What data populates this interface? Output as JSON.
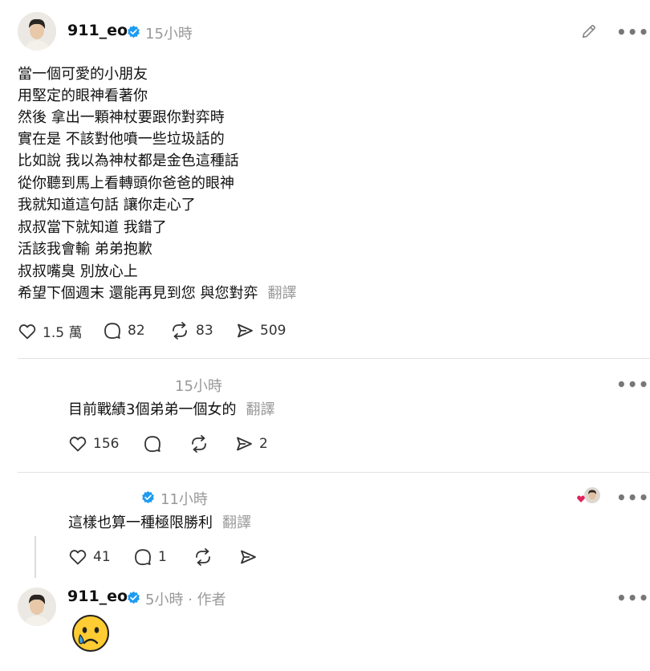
{
  "main_post": {
    "username": "911_eo",
    "time": "15小時",
    "lines": [
      "當一個可愛的小朋友",
      "用堅定的眼神看著你",
      "然後 拿出一顆神杖要跟你對弈時",
      "實在是 不該對他噴一些垃圾話的",
      "比如說 我以為神杖都是金色這種話",
      "從你聽到馬上看轉頭你爸爸的眼神",
      "我就知道這句話 讓你走心了",
      "叔叔當下就知道 我錯了",
      "活該我會輸 弟弟抱歉",
      "叔叔嘴臭 別放心上",
      "希望下個週末 還能再見到您 與您對弈"
    ],
    "translate": "翻譯",
    "likes": "1.5 萬",
    "comments": "82",
    "reposts": "83",
    "shares": "509"
  },
  "reply1": {
    "time": "15小時",
    "text": "目前戰績3個弟弟一個女的",
    "translate": "翻譯",
    "likes": "156",
    "shares": "2"
  },
  "reply2": {
    "time": "11小時",
    "text": "這樣也算一種極限勝利",
    "translate": "翻譯",
    "likes": "41",
    "comments": "1"
  },
  "reply3": {
    "username": "911_eo",
    "time": "5小時",
    "separator": "·",
    "author_tag": "作者",
    "emoji": "😢"
  },
  "icons": {
    "more": "•••",
    "verified_color": "#1d9bf0"
  }
}
